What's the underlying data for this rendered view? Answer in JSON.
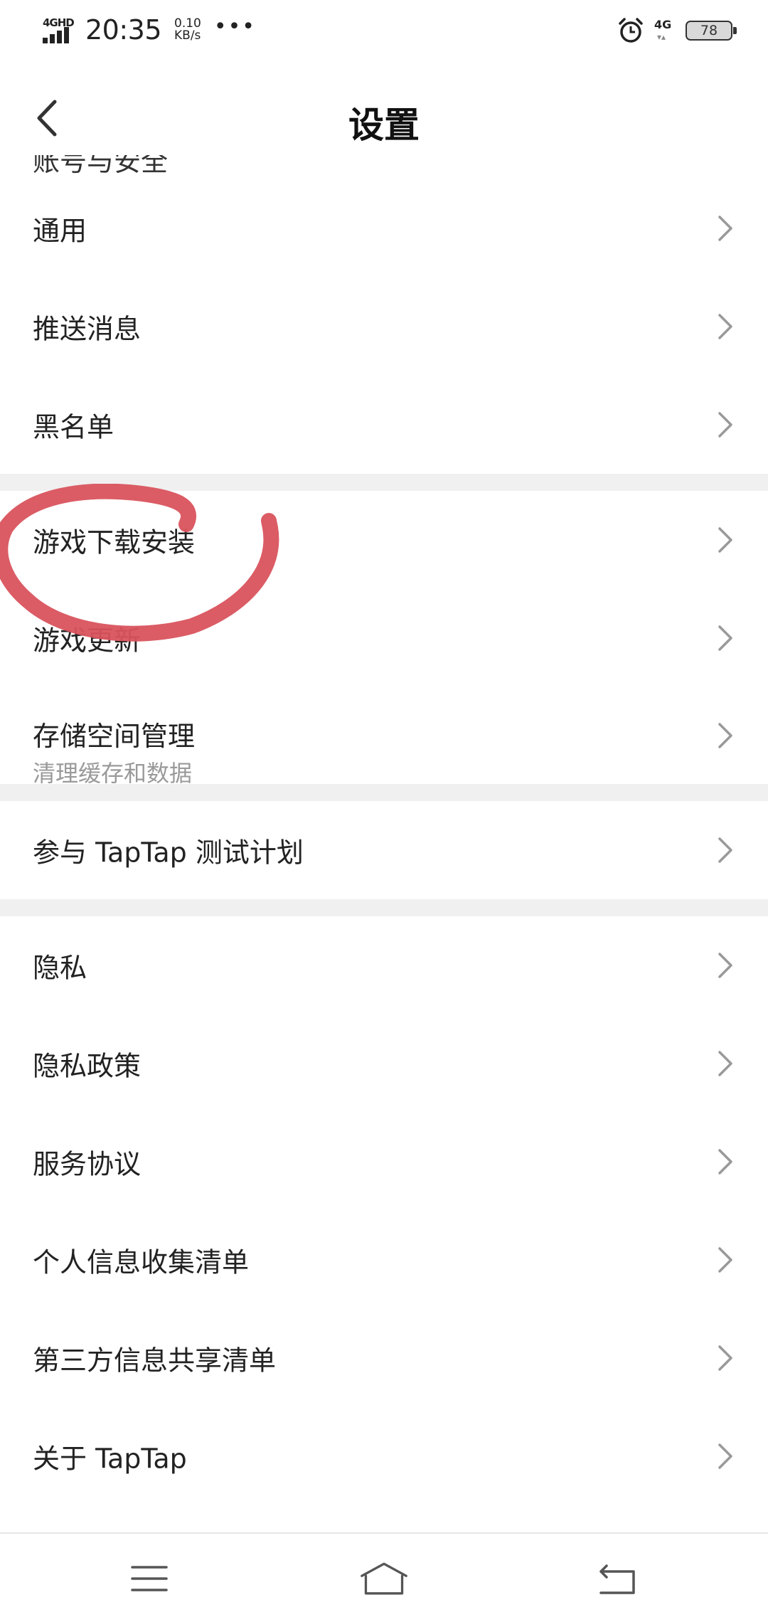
{
  "status_bar": {
    "signal_label": "4GHD",
    "time": "20:35",
    "speed_value": "0.10",
    "speed_unit": "KB/s",
    "more": "•••",
    "network": "4G",
    "battery": "78"
  },
  "header": {
    "title": "设置"
  },
  "list": {
    "cut_item": "账号与安全",
    "items": [
      {
        "label": "通用"
      },
      {
        "label": "推送消息"
      },
      {
        "label": "黑名单"
      },
      {
        "label": "游戏下载安装"
      },
      {
        "label": "游戏更新"
      },
      {
        "label": "存储空间管理",
        "sublabel": "清理缓存和数据"
      },
      {
        "label": "参与 TapTap 测试计划"
      },
      {
        "label": "隐私"
      },
      {
        "label": "隐私政策"
      },
      {
        "label": "服务协议"
      },
      {
        "label": "个人信息收集清单"
      },
      {
        "label": "第三方信息共享清单"
      },
      {
        "label": "关于 TapTap"
      }
    ]
  },
  "icons": {
    "back": "chevron-left-icon",
    "row_arrow": "chevron-right-icon",
    "nav_menu": "menu-icon",
    "nav_home": "home-icon",
    "nav_back": "back-icon"
  },
  "colors": {
    "annotation": "#d9535d",
    "divider": "#f0f0f0",
    "sublabel": "#9a9a9a"
  }
}
